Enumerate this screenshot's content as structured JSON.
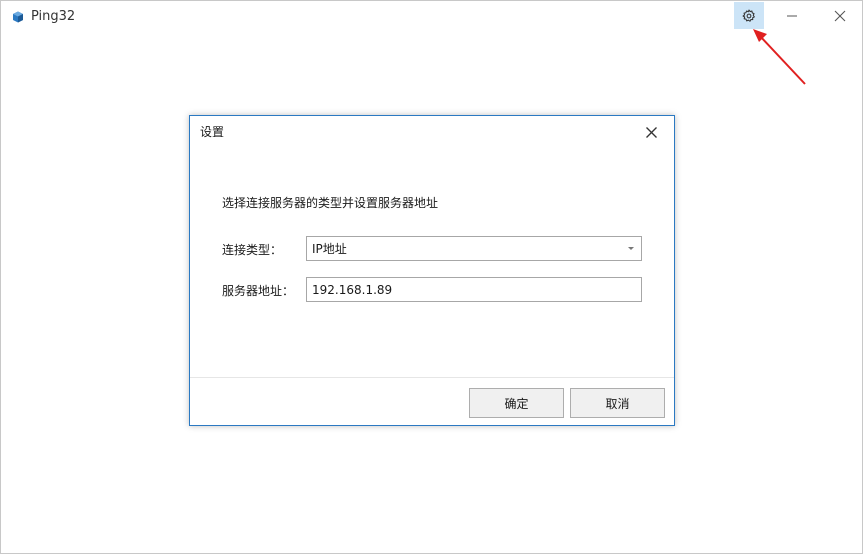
{
  "app": {
    "title": "Ping32",
    "icon": "cube-icon",
    "accent_color": "#2b79c2"
  },
  "titlebar": {
    "settings_icon": "gear-icon",
    "minimize_icon": "minimize-icon",
    "close_icon": "close-icon",
    "settings_highlight_color": "#cce4f7"
  },
  "annotation": {
    "type": "red-arrow",
    "color": "#e02020",
    "points_to": "settings-button"
  },
  "dialog": {
    "title": "设置",
    "instruction": "选择连接服务器的类型并设置服务器地址",
    "connection_type": {
      "label": "连接类型：",
      "value": "IP地址"
    },
    "server_address": {
      "label": "服务器地址：",
      "value": "192.168.1.89"
    },
    "buttons": {
      "ok": "确定",
      "cancel": "取消"
    }
  }
}
